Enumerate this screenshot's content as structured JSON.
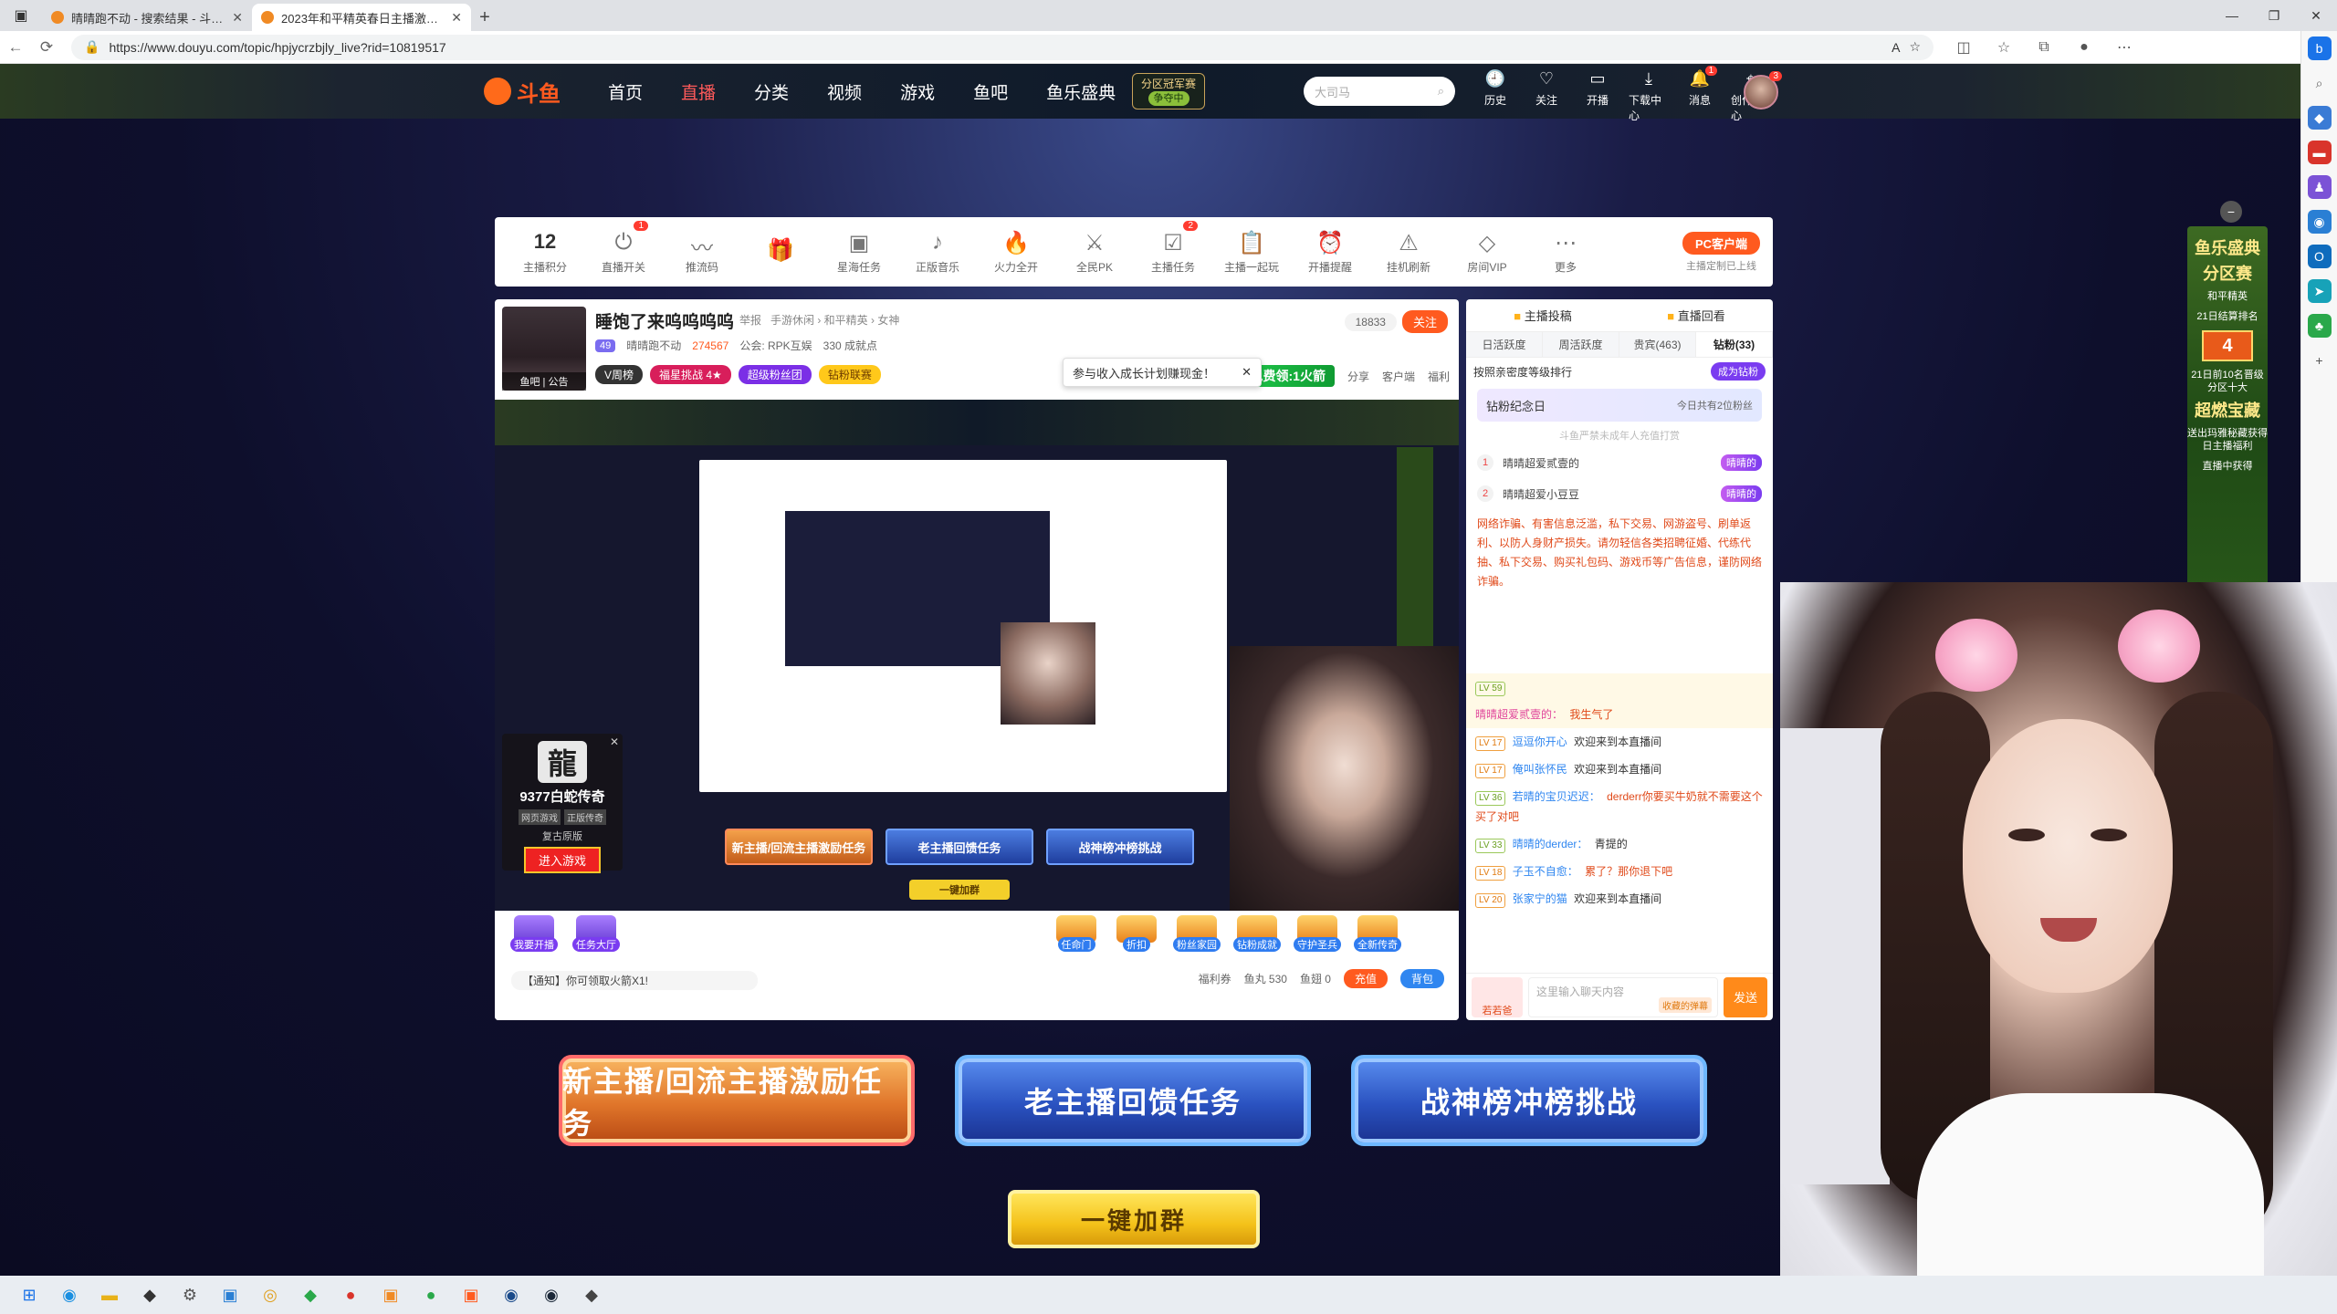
{
  "browser": {
    "tabs": [
      {
        "title": "晴晴跑不动 - 搜索结果 - 斗鱼直播",
        "active": false
      },
      {
        "title": "2023年和平精英春日主播激励活动",
        "active": true
      }
    ],
    "url": "https://www.douyu.com/topic/hpjycrzbjly_live?rid=10819517",
    "new_tab": "+",
    "window_controls": [
      "—",
      "❐",
      "✕"
    ]
  },
  "douyu_header": {
    "logo": "斗鱼",
    "nav": [
      "首页",
      "直播",
      "分类",
      "视频",
      "游戏",
      "鱼吧",
      "鱼乐盛典"
    ],
    "nav_active": "直播",
    "season": {
      "title": "分区冠军赛",
      "sub": "争夺中"
    },
    "search_placeholder": "大司马",
    "actions": [
      {
        "label": "历史",
        "icon": "🕘"
      },
      {
        "label": "关注",
        "icon": "♡"
      },
      {
        "label": "开播",
        "icon": "▭"
      },
      {
        "label": "下载中心",
        "icon": "⤓"
      },
      {
        "label": "消息",
        "icon": "🔔",
        "badge": "1"
      },
      {
        "label": "创作中心",
        "icon": "⌖"
      }
    ],
    "avatar_badge": "3"
  },
  "anchor_toolbar": {
    "score": "12",
    "items": [
      {
        "label": "主播积分"
      },
      {
        "label": "直播开关",
        "badge": "1"
      },
      {
        "label": "推流码"
      },
      {
        "label": ""
      },
      {
        "label": "星海任务"
      },
      {
        "label": "正版音乐"
      },
      {
        "label": "火力全开"
      },
      {
        "label": "全民PK"
      },
      {
        "label": "主播任务",
        "badge": "2"
      },
      {
        "label": "主播一起玩"
      },
      {
        "label": "开播提醒"
      },
      {
        "label": "挂机刷新"
      },
      {
        "label": "房间VIP"
      },
      {
        "label": "更多"
      }
    ],
    "pc_client_btn": "PC客户端",
    "pc_client_sub": "主播定制已上线"
  },
  "room": {
    "title": "睡饱了来呜呜呜呜",
    "report": "举报",
    "category": "手游休闲 › 和平精英 › 女神",
    "level": "49",
    "streamer": "晴晴跑不动",
    "hot": "274567",
    "guild": "公会: RPK互娱",
    "achievements": "330 成就点",
    "avatar_label": "鱼吧 | 公告",
    "pills": [
      "V周榜",
      "福星挑战 4★",
      "超级粉丝团",
      "钻粉联赛"
    ],
    "follow_count": "18833",
    "follow_btn": "关注",
    "tip_popup": "参与收入成长计划赚现金！",
    "free_gift": "免费领:1火箭",
    "right_actions": [
      "分享",
      "客户端",
      "福利"
    ]
  },
  "nested_stream": {
    "buttons": [
      "新主播/回流主播激励任务",
      "老主播回馈任务",
      "战神榜冲榜挑战"
    ],
    "join": "一键加群"
  },
  "ad_game": {
    "logo": "龍",
    "name": "9377白蛇传奇",
    "tags": [
      "网页游戏",
      "正版传奇"
    ],
    "sub": "复古原版",
    "play": "进入游戏"
  },
  "gift_bar": {
    "left": [
      "我要开播",
      "任务大厅"
    ],
    "right": [
      "任命门",
      "折扣",
      "粉丝家园",
      "钻粉成就",
      "守护圣兵",
      "全新传奇"
    ]
  },
  "notice": {
    "text": "【通知】你可领取火箭X1!",
    "fish_balls": "鱼丸 530",
    "fish_fins": "鱼翅 0",
    "welfare": "福利券",
    "charge": "充值",
    "bag": "背包"
  },
  "chat": {
    "top": [
      "主播投稿",
      "直播回看"
    ],
    "rank_tabs": [
      "日活跃度",
      "周活跃度",
      "贵宾(463)",
      "钻粉(33)"
    ],
    "rank_active": "钻粉(33)",
    "rank_header": "按照亲密度等级排行",
    "become_diamond": "成为钻粉",
    "diamond_banner": "钻粉纪念日",
    "diamond_banner_sub": "今日共有2位粉丝",
    "rank_hint": "斗鱼严禁未成年人充值打赏",
    "rank_rows": [
      {
        "n": "1",
        "name": "晴晴超爱贰壹的",
        "tag": "晴晴的"
      },
      {
        "n": "2",
        "name": "晴晴超爱小豆豆",
        "tag": "晴晴的"
      }
    ],
    "warning": "网络诈骗、有害信息泛滥，私下交易、网游盗号、刷单返利、以防人身财产损失。请勿轻信各类招聘征婚、代练代抽、私下交易、购买礼包码、游戏币等广告信息，谨防网络诈骗。",
    "messages": [
      {
        "lv": "LV 59",
        "user": "",
        "text": ""
      },
      {
        "lv": "",
        "user": "晴晴超爱贰壹的：",
        "text": "我生气了",
        "red": true
      },
      {
        "lv": "LV 17",
        "user": "逗逗你开心",
        "text": "欢迎来到本直播间"
      },
      {
        "lv": "LV 17",
        "user": "俺叫张怀民",
        "text": "欢迎来到本直播间"
      },
      {
        "lv": "LV 36",
        "user": "若晴的宝贝迟迟：",
        "text": "derderr你要买牛奶就不需要这个买了对吧",
        "red": true
      },
      {
        "lv": "LV 33",
        "user": "晴晴的derder：",
        "text": "青提的"
      },
      {
        "lv": "LV 18",
        "user": "子玉不自愈：",
        "text": "累了？那你退下吧",
        "red": true
      },
      {
        "lv": "LV 20",
        "user": "张家宁的猫",
        "text": "欢迎来到本直播间"
      }
    ],
    "input_placeholder": "这里输入聊天内容",
    "avatar_mini": "若若爸",
    "bullet_tag": "收藏的弹幕",
    "send": "发送"
  },
  "promo_side": {
    "title": "鱼乐盛典",
    "sub1": "分区赛",
    "sub2": "和平精英",
    "sub3": "21日结算排名",
    "rank": "4",
    "sub4": "21日前10名晋级分区十大",
    "sub5": "超燃宝藏",
    "sub6": "送出玛雅秘藏获得日主播福利",
    "sub7": "直播中获得"
  },
  "big_buttons": [
    "新主播/回流主播激励任务",
    "老主播回馈任务",
    "战神榜冲榜挑战"
  ],
  "join_group": "一键加群"
}
